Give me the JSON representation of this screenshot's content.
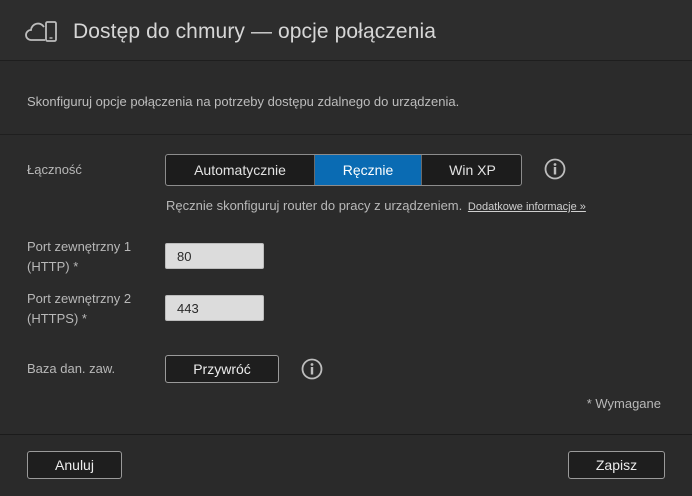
{
  "header": {
    "title": "Dostęp do chmury — opcje połączenia",
    "icon": "cloud-device-icon"
  },
  "description": "Skonfiguruj opcje połączenia na potrzeby dostępu zdalnego do urządzenia.",
  "connectivity": {
    "label": "Łączność",
    "options": [
      "Automatycznie",
      "Ręcznie",
      "Win XP"
    ],
    "selected": "Ręcznie",
    "hint": "Ręcznie skonfiguruj router do pracy z urządzeniem.",
    "more_link": "Dodatkowe informacje »"
  },
  "port1": {
    "label_line1": "Port zewnętrzny 1",
    "label_line2": "(HTTP) *",
    "value": "80"
  },
  "port2": {
    "label_line1": "Port zewnętrzny 2",
    "label_line2": "(HTTPS) *",
    "value": "443"
  },
  "database": {
    "label": "Baza dan. zaw.",
    "restore_label": "Przywróć"
  },
  "required_note": "* Wymagane",
  "footer": {
    "cancel_label": "Anuluj",
    "save_label": "Zapisz"
  },
  "colors": {
    "accent": "#0a6bb3",
    "background": "#2b2b2b"
  }
}
